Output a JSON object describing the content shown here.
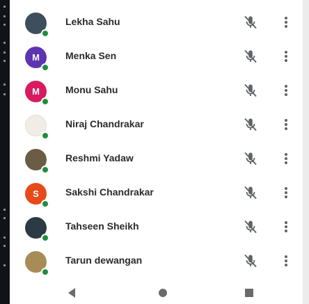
{
  "participants": [
    {
      "name": "Lekha Sahu",
      "avatar_color": "#3d4e5c",
      "avatar_icon": "floral-photo-avatar",
      "avatar_initial": ""
    },
    {
      "name": "Menka Sen",
      "avatar_color": "#5e35b1",
      "avatar_icon": "letter-avatar",
      "avatar_initial": "M"
    },
    {
      "name": "Monu Sahu",
      "avatar_color": "#d81b60",
      "avatar_icon": "letter-avatar",
      "avatar_initial": "M"
    },
    {
      "name": "Niraj Chandrakar",
      "avatar_color": "#f1ede6",
      "avatar_icon": "blank-photo-avatar",
      "avatar_initial": ""
    },
    {
      "name": "Reshmi Yadaw",
      "avatar_color": "#6b5d45",
      "avatar_icon": "photo-avatar",
      "avatar_initial": ""
    },
    {
      "name": "Sakshi Chandrakar",
      "avatar_color": "#e64a19",
      "avatar_icon": "letter-avatar",
      "avatar_initial": "S"
    },
    {
      "name": "Tahseen Sheikh",
      "avatar_color": "#2c3a44",
      "avatar_icon": "photo-avatar",
      "avatar_initial": ""
    },
    {
      "name": "Tarun dewangan",
      "avatar_color": "#a88c56",
      "avatar_icon": "photo-avatar",
      "avatar_initial": ""
    }
  ],
  "row_actions": {
    "mic_icon": "mic-off-icon",
    "more_icon": "more-vert-icon"
  },
  "nav": {
    "back_icon": "back-triangle-icon",
    "home_icon": "home-circle-icon",
    "recents_icon": "recents-square-icon"
  },
  "colors": {
    "presence": "#1e8e3e",
    "icon": "#5f6368",
    "nav_icon": "#6b6b6b"
  }
}
